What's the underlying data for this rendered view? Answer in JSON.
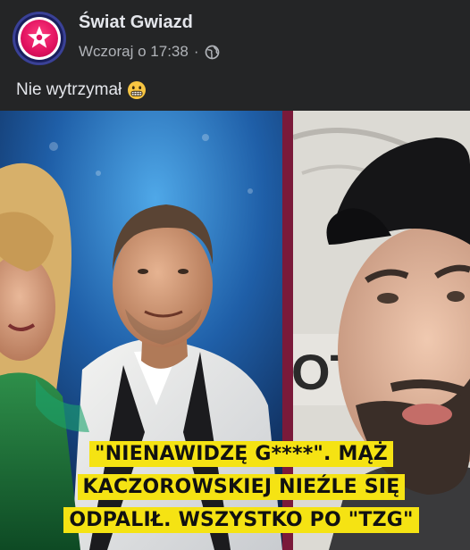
{
  "post": {
    "page_name": "Świat Gwiazd",
    "timestamp": "Wczoraj o 17:38",
    "separator": "·",
    "privacy_icon": "globe-icon",
    "caption": "Nie wytrzymał",
    "caption_emoji": "grimacing-face-emoji",
    "avatar_icon": "star-icon"
  },
  "image": {
    "headline_lines": [
      "\"NIENAWIDZĘ G****\". MĄŻ",
      "KACZOROWSKIEJ NIEŹLE SIĘ",
      "ODPALIŁ. WSZYSTKO PO \"TZG\""
    ],
    "background_sign_text": "OTE"
  },
  "colors": {
    "post_background": "#242526",
    "primary_text": "#e4e6eb",
    "secondary_text": "#b0b3b8",
    "headline_highlight": "#f5e313",
    "divider_accent": "#7a1a3a",
    "brand_pink": "#e0115f"
  }
}
